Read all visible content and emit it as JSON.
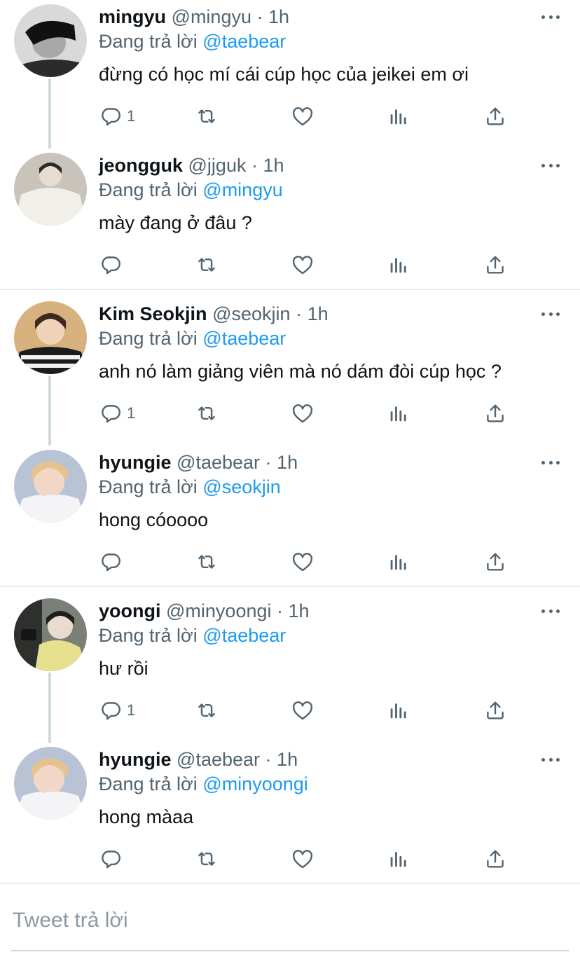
{
  "tweets": [
    {
      "name": "mingyu",
      "handle": "@mingyu",
      "sep": "·",
      "time": "1h",
      "replying_prefix": "Đang trả lời",
      "replying_to": "@taebear",
      "text": "đừng có học mí cái cúp học của jeikei em ơi",
      "reply_count": "1",
      "avatar_colors": {
        "bg": "#d9d9d9",
        "skin": "#a8a8a8",
        "hair": "#111111",
        "cloth": "#2b2b2b"
      }
    },
    {
      "name": "jeongguk",
      "handle": "@jjguk",
      "sep": "·",
      "time": "1h",
      "replying_prefix": "Đang trả lời",
      "replying_to": "@mingyu",
      "text": "mày đang ở đâu ?",
      "reply_count": "",
      "avatar_colors": {
        "bg": "#c9c4bb",
        "skin": "#e7dccd",
        "hair": "#2a2a2a",
        "cloth": "#f1efea"
      }
    },
    {
      "name": "Kim Seokjin",
      "handle": "@seokjin",
      "sep": "·",
      "time": "1h",
      "replying_prefix": "Đang trả lời",
      "replying_to": "@taebear",
      "text": "anh nó làm giảng viên mà nó dám đòi cúp học ?",
      "reply_count": "1",
      "avatar_colors": {
        "bg": "#d8b27e",
        "skin": "#f0d2b8",
        "hair": "#3a2a1f",
        "cloth": "#1c1c1c"
      }
    },
    {
      "name": "hyungie",
      "handle": "@taebear",
      "sep": "·",
      "time": "1h",
      "replying_prefix": "Đang trả lời",
      "replying_to": "@seokjin",
      "text": "hong cóoooo",
      "reply_count": "",
      "avatar_colors": {
        "bg": "#b9c3d6",
        "skin": "#f2d7c6",
        "hair": "#e6c28f",
        "cloth": "#f4f4f6"
      }
    },
    {
      "name": "yoongi",
      "handle": "@minyoongi",
      "sep": "·",
      "time": "1h",
      "replying_prefix": "Đang trả lời",
      "replying_to": "@taebear",
      "text": "hư rồi",
      "reply_count": "1",
      "avatar_colors": {
        "bg": "#7a7f78",
        "skin": "#e9dccf",
        "hair": "#1e1e1e",
        "cloth": "#e6e08f"
      }
    },
    {
      "name": "hyungie",
      "handle": "@taebear",
      "sep": "·",
      "time": "1h",
      "replying_prefix": "Đang trả lời",
      "replying_to": "@minyoongi",
      "text": "hong màaa",
      "reply_count": "",
      "avatar_colors": {
        "bg": "#b9c3d6",
        "skin": "#f2d7c6",
        "hair": "#e6c28f",
        "cloth": "#f4f4f6"
      }
    }
  ],
  "composer": {
    "placeholder": "Tweet trả lời"
  },
  "colors": {
    "link": "#1d9bf0",
    "secondary": "#536471",
    "divider": "#e6ecf0",
    "thread": "#cfd9de"
  },
  "icons": [
    "reply-icon",
    "retweet-icon",
    "like-icon",
    "analytics-icon",
    "share-icon",
    "more-icon"
  ]
}
